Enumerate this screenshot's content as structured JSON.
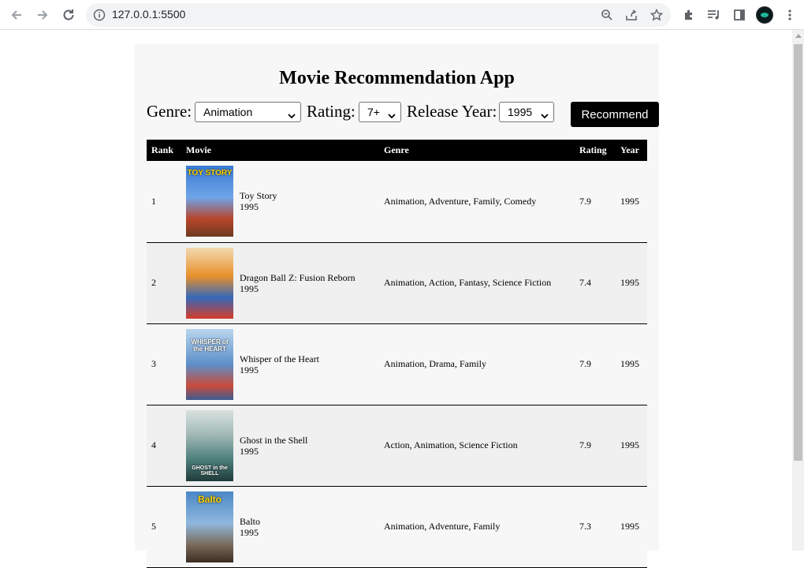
{
  "browser": {
    "url": "127.0.0.1:5500",
    "icons": [
      "back-icon",
      "forward-icon",
      "reload-icon",
      "info-icon",
      "zoom-icon",
      "share-icon",
      "star-icon",
      "extensions-icon",
      "media-icon",
      "sidepanel-icon",
      "menu-icon"
    ]
  },
  "app": {
    "title": "Movie Recommendation App",
    "genre_label": "Genre:",
    "genre_value": "Animation",
    "rating_label": "Rating:",
    "rating_value": "7+",
    "year_label": "Release Year:",
    "year_value": "1995",
    "recommend_label": "Recommend"
  },
  "table": {
    "headers": [
      "Rank",
      "Movie",
      "Genre",
      "Rating",
      "Year"
    ],
    "rows": [
      {
        "rank": "1",
        "title": "Toy Story",
        "year": "1995",
        "genre": "Animation, Adventure, Family, Comedy",
        "rating": "7.9",
        "poster_text": "TOY STORY",
        "poster_color": "#3a7bd5"
      },
      {
        "rank": "2",
        "title": "Dragon Ball Z: Fusion Reborn",
        "year": "1995",
        "genre": "Animation, Action, Fantasy, Science Fiction",
        "rating": "7.4",
        "poster_text": "",
        "poster_color": "#e8902a"
      },
      {
        "rank": "3",
        "title": "Whisper of the Heart",
        "year": "1995",
        "genre": "Animation, Drama, Family",
        "rating": "7.9",
        "poster_text": "WHISPER of the HEART",
        "poster_color": "#5d8fc9"
      },
      {
        "rank": "4",
        "title": "Ghost in the Shell",
        "year": "1995",
        "genre": "Action, Animation, Science Fiction",
        "rating": "7.9",
        "poster_text": "GHOST in the SHELL",
        "poster_color": "#4c7d7a"
      },
      {
        "rank": "5",
        "title": "Balto",
        "year": "1995",
        "genre": "Animation, Adventure, Family",
        "rating": "7.3",
        "poster_text": "Balto",
        "poster_color": "#4a88c7"
      }
    ]
  }
}
